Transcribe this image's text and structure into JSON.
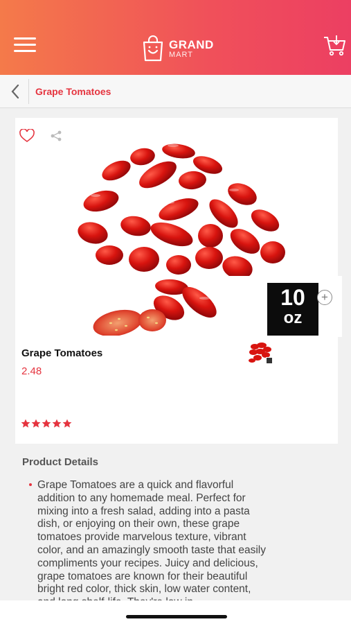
{
  "header": {
    "brand_line1": "GRAND",
    "brand_line2": "MART",
    "menu_icon": "hamburger-menu-icon",
    "cart_icon": "cart-icon",
    "colors": {
      "gradient_start": "#f47a4a",
      "gradient_end": "#ec3f62"
    }
  },
  "breadcrumb": {
    "back_icon": "chevron-left-icon",
    "title": "Grape Tomatoes"
  },
  "product": {
    "name": "Grape Tomatoes",
    "price": "2.48",
    "size_value": "10",
    "size_unit": "oz",
    "add_symbol": "+",
    "rating": 5,
    "rating_max": 5,
    "favorite_icon": "heart-outline-icon",
    "share_icon": "share-icon",
    "accent_color": "#e5343f"
  },
  "details": {
    "heading": "Product Details",
    "description": "Grape Tomatoes are a quick and flavorful addition to any homemade meal. Perfect for mixing into a fresh salad, adding into a pasta dish, or enjoying on their own, these grape tomatoes provide marvelous texture, vibrant color, and an amazingly smooth taste that easily compliments your recipes. Juicy and delicious, grape tomatoes are known for their beautiful bright red color, thick skin, low water content, and long shelf-life. They're low in"
  }
}
